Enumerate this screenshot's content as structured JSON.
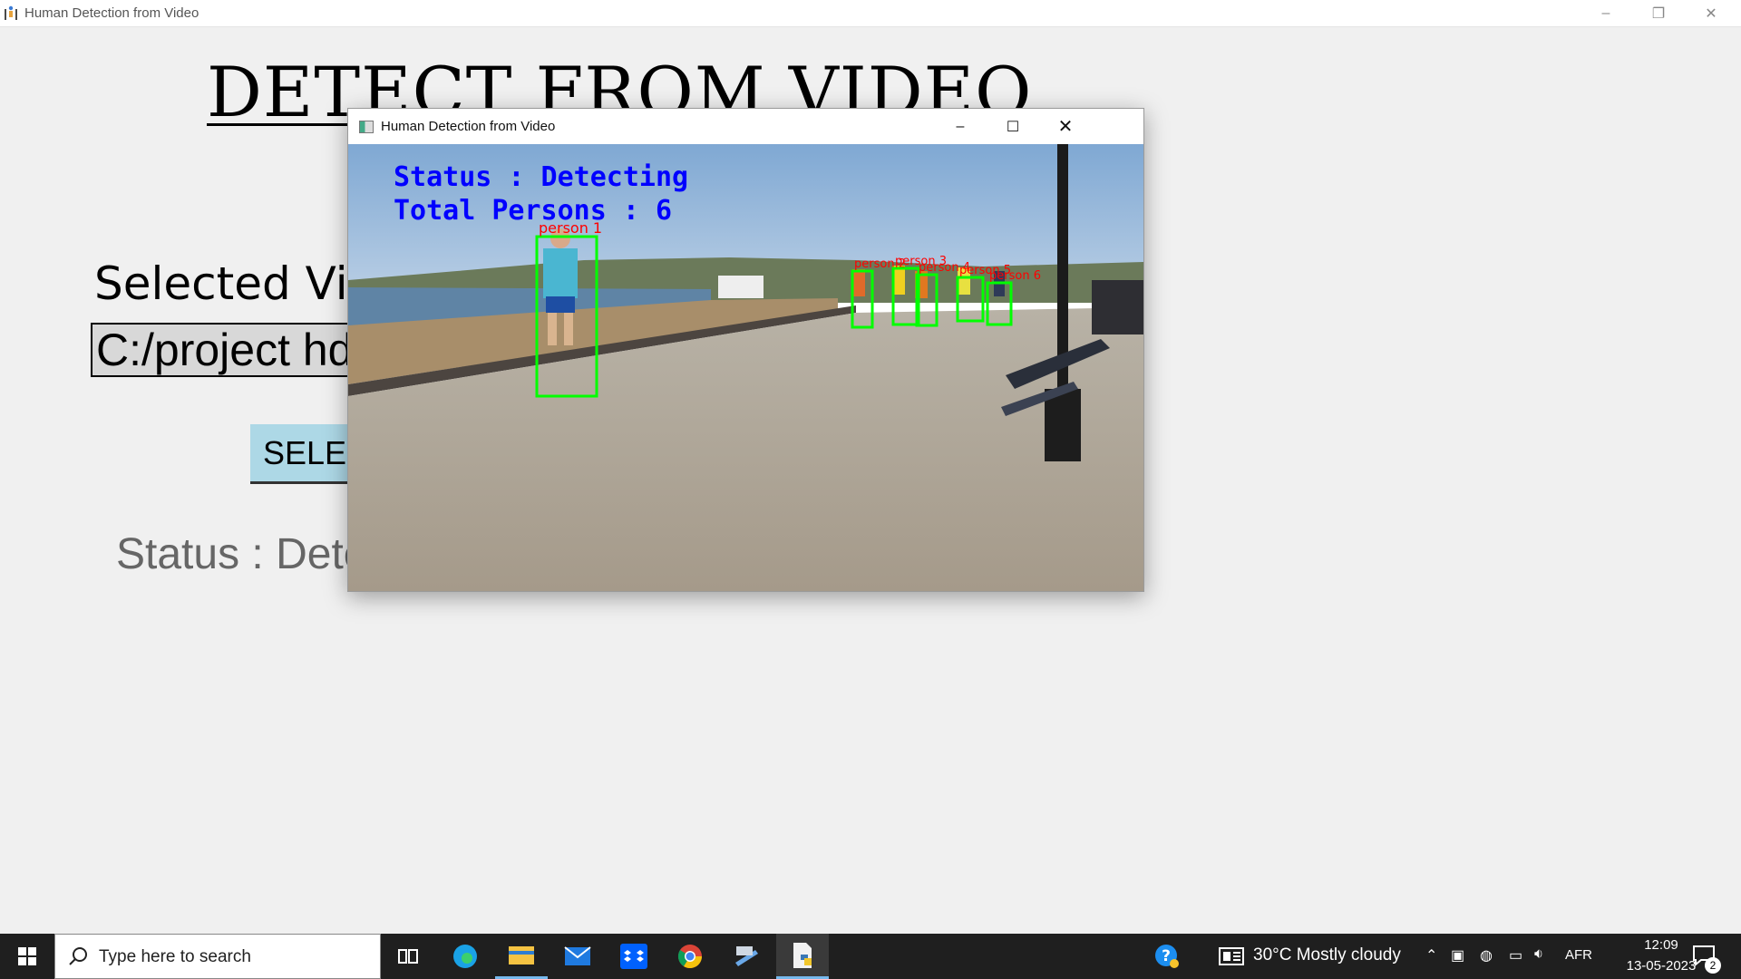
{
  "main_window": {
    "title": "Human Detection from Video",
    "minimize": "–",
    "maximize": "❐",
    "close": "✕"
  },
  "app": {
    "heading": "DETECT  FROM VIDEO",
    "selected_label": "Selected Video",
    "path_value": "C:/project hd",
    "select_button": "SELECT",
    "status": "Status : Detecting"
  },
  "video_window": {
    "title": "Human Detection from Video",
    "minimize": "–",
    "maximize": "☐",
    "close": "✕",
    "overlay_status": "Status : Detecting",
    "overlay_total": "Total Persons : 6",
    "box_color": "#00ff00",
    "label_color": "#ff0000",
    "overlay_color": "#0000ff",
    "detections": [
      {
        "label": "person 1"
      },
      {
        "label": "person 2"
      },
      {
        "label": "person 3"
      },
      {
        "label": "person 4"
      },
      {
        "label": "person 5"
      },
      {
        "label": "person 6"
      }
    ]
  },
  "taskbar": {
    "search_placeholder": "Type here to search",
    "weather": "30°C  Mostly cloudy",
    "language": "AFR",
    "time": "12:09",
    "date": "13-05-2023",
    "notifications": "2",
    "pinned": [
      "task-view-icon",
      "edge-icon",
      "file-explorer-icon",
      "mail-icon",
      "dropbox-icon",
      "chrome-icon",
      "app-icon",
      "python-idle-icon"
    ]
  }
}
